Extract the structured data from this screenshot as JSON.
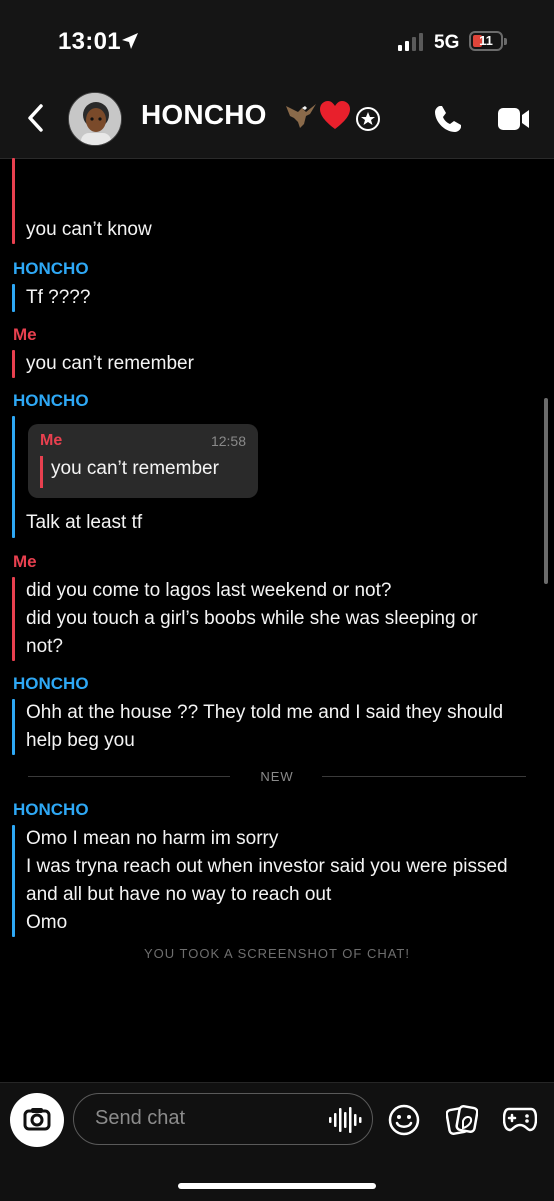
{
  "status": {
    "time": "13:01",
    "network": "5G",
    "battery": "11",
    "battery_color": "#e0453a"
  },
  "header": {
    "title": "HONCHO",
    "emoji_icons": [
      "eagle-icon",
      "heart-icon"
    ],
    "badge_icon": "star-badge-icon"
  },
  "chat": {
    "messages": [
      {
        "sender": "",
        "lines": [
          "you can’t know"
        ]
      },
      {
        "sender": "HONCHO",
        "lines": [
          "Tf ????"
        ]
      },
      {
        "sender": "Me",
        "lines": [
          "you can’t remember"
        ]
      },
      {
        "sender": "HONCHO",
        "quote": {
          "sender": "Me",
          "time": "12:58",
          "text": "you can’t remember"
        },
        "lines": [
          "Talk at least tf"
        ]
      },
      {
        "sender": "Me",
        "lines": [
          "did you come to lagos last weekend or not?",
          "did you touch a girl’s boobs while she was sleeping or",
          "not?"
        ]
      },
      {
        "sender": "HONCHO",
        "lines": [
          "Ohh at the house ?? They told me and I said they should",
          "help beg you"
        ]
      },
      {
        "sender": "HONCHO",
        "lines": [
          "Omo I mean no harm im sorry",
          "I was tryna reach out when investor said you were pissed",
          "and all but have no way to reach out",
          "Omo"
        ]
      }
    ],
    "new_label": "NEW",
    "system_notice": "YOU TOOK A SCREENSHOT OF CHAT!"
  },
  "composer": {
    "placeholder": "Send chat"
  },
  "colors": {
    "them": "#2ea8f5",
    "me": "#e8404f",
    "background": "#000000"
  }
}
